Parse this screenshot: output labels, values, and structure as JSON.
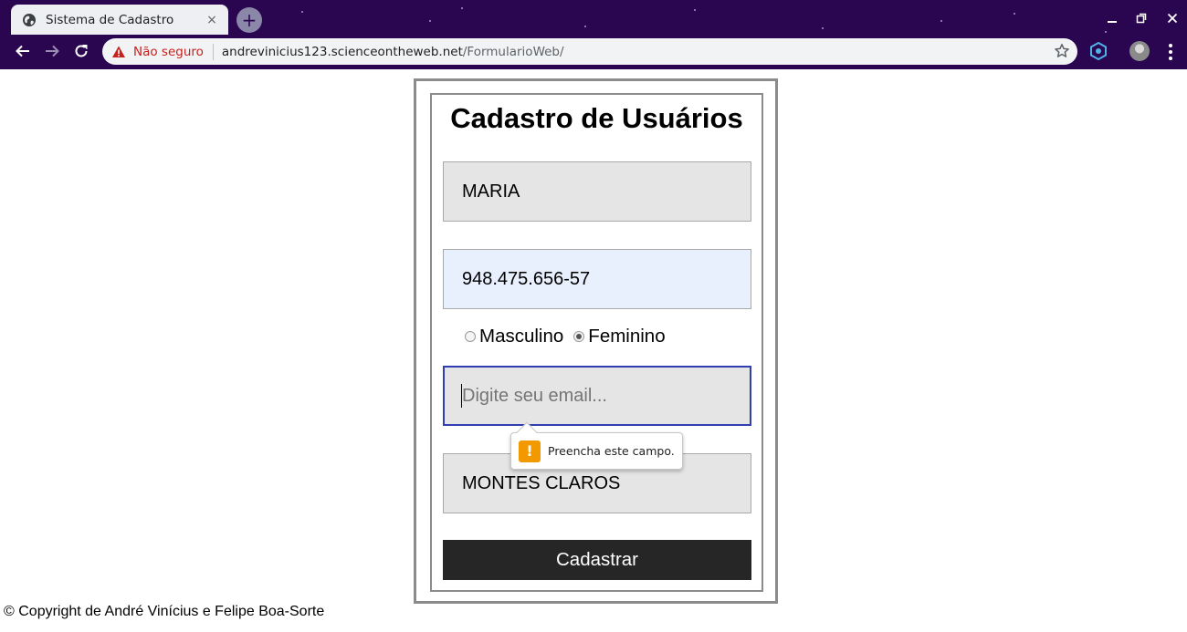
{
  "browser": {
    "tab_title": "Sistema de Cadastro",
    "tab_close": "×",
    "new_tab": "+",
    "security_label": "Não seguro",
    "url_host": "andrevinicius123.scienceontheweb.net",
    "url_path": "/FormularioWeb/"
  },
  "form": {
    "title": "Cadastro de Usuários",
    "name_value": "MARIA",
    "cpf_value": "948.475.656-57",
    "gender_options": [
      "Masculino",
      "Feminino"
    ],
    "gender_selected": "Feminino",
    "email_value": "",
    "email_placeholder": "Digite seu email...",
    "city_value": "MONTES CLAROS",
    "submit_label": "Cadastrar"
  },
  "validation": {
    "message": "Preencha este campo.",
    "icon_glyph": "!"
  },
  "footer": {
    "copyright": "© Copyright de André Vinícius e Felipe Boa-Sorte"
  },
  "colors": {
    "chrome_bg": "#2a0650",
    "submit_bg": "#262626",
    "warning": "#f29900",
    "insecure": "#c5221f"
  }
}
